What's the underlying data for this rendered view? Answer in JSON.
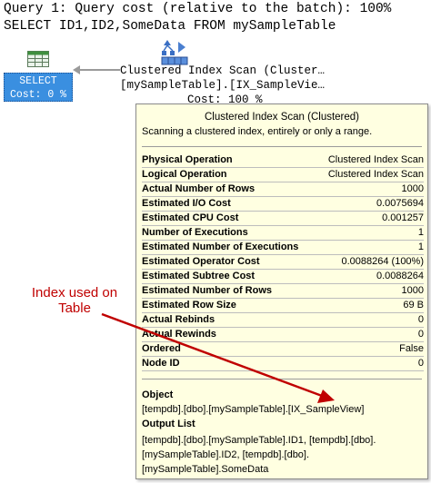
{
  "header": {
    "query_line": "Query 1: Query cost (relative to the batch): 100%",
    "sql_line": "SELECT ID1,ID2,SomeData FROM mySampleTable"
  },
  "plan": {
    "select_node": {
      "label": "SELECT",
      "cost": "Cost: 0 %"
    },
    "scan_node": {
      "label_line1": "Clustered Index Scan (Cluster…",
      "label_line2": "[mySampleTable].[IX_SampleVie…",
      "cost": "Cost: 100 %"
    }
  },
  "tooltip": {
    "title": "Clustered Index Scan (Clustered)",
    "description": "Scanning a clustered index, entirely or only a range.",
    "properties": [
      {
        "key": "Physical Operation",
        "value": "Clustered Index Scan"
      },
      {
        "key": "Logical Operation",
        "value": "Clustered Index Scan"
      },
      {
        "key": "Actual Number of Rows",
        "value": "1000"
      },
      {
        "key": "Estimated I/O Cost",
        "value": "0.0075694"
      },
      {
        "key": "Estimated CPU Cost",
        "value": "0.001257"
      },
      {
        "key": "Number of Executions",
        "value": "1"
      },
      {
        "key": "Estimated Number of Executions",
        "value": "1"
      },
      {
        "key": "Estimated Operator Cost",
        "value": "0.0088264 (100%)"
      },
      {
        "key": "Estimated Subtree Cost",
        "value": "0.0088264"
      },
      {
        "key": "Estimated Number of Rows",
        "value": "1000"
      },
      {
        "key": "Estimated Row Size",
        "value": "69 B"
      },
      {
        "key": "Actual Rebinds",
        "value": "0"
      },
      {
        "key": "Actual Rewinds",
        "value": "0"
      },
      {
        "key": "Ordered",
        "value": "False"
      },
      {
        "key": "Node ID",
        "value": "0"
      }
    ],
    "object_title": "Object",
    "object_value": "[tempdb].[dbo].[mySampleTable].[IX_SampleView]",
    "output_title": "Output List",
    "output_lines": [
      "[tempdb].[dbo].[mySampleTable].ID1, [tempdb].[dbo].",
      "[mySampleTable].ID2, [tempdb].[dbo].",
      "[mySampleTable].SomeData"
    ]
  },
  "annotation": {
    "line1": "Index used on",
    "line2": "Table"
  },
  "colors": {
    "select_node": "#3a8fe0",
    "tooltip_bg": "#ffffe1",
    "annotation": "#c00000"
  },
  "icons": {
    "select": "table-grid-icon",
    "scan": "clustered-index-scan-icon"
  }
}
